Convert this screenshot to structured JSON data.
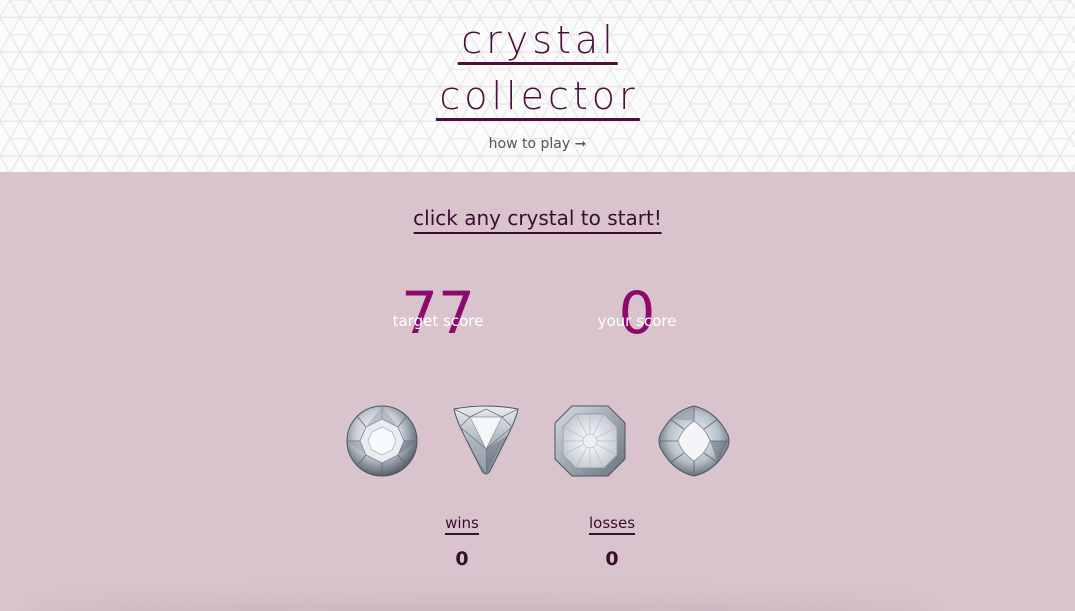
{
  "header": {
    "title_line1": "crystal",
    "title_line2": "collector",
    "how_to_play": "how to play ➞"
  },
  "game": {
    "start_message": "click any crystal to start!",
    "target_score_value": "77",
    "target_score_label": "target score",
    "your_score_value": "0",
    "your_score_label": "your score",
    "crystals": [
      {
        "name": "round-brilliant-crystal"
      },
      {
        "name": "trillion-crystal"
      },
      {
        "name": "octagon-crystal"
      },
      {
        "name": "oval-crystal"
      }
    ]
  },
  "tally": {
    "wins_label": "wins",
    "wins_value": "0",
    "losses_label": "losses",
    "losses_value": "0"
  },
  "colors": {
    "header_bg": "#fbfbfb",
    "main_bg": "#d9c3cc",
    "title": "#4a0f3a",
    "score_number": "#8b0a6b",
    "score_label": "#ffffff"
  }
}
